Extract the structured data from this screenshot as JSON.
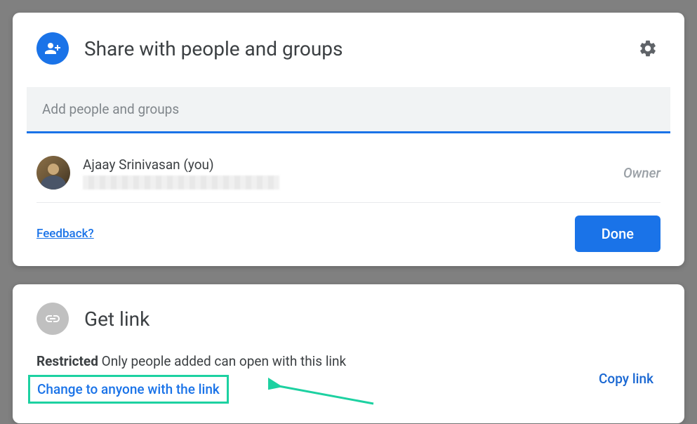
{
  "share": {
    "title": "Share with people and groups",
    "input_placeholder": "Add people and groups",
    "people": [
      {
        "name": "Ajaay Srinivasan (you)",
        "role": "Owner"
      }
    ],
    "feedback_label": "Feedback?",
    "done_label": "Done"
  },
  "getlink": {
    "title": "Get link",
    "status_bold": "Restricted",
    "status_text": " Only people added can open with this link",
    "change_label": "Change to anyone with the link",
    "copy_label": "Copy link"
  }
}
